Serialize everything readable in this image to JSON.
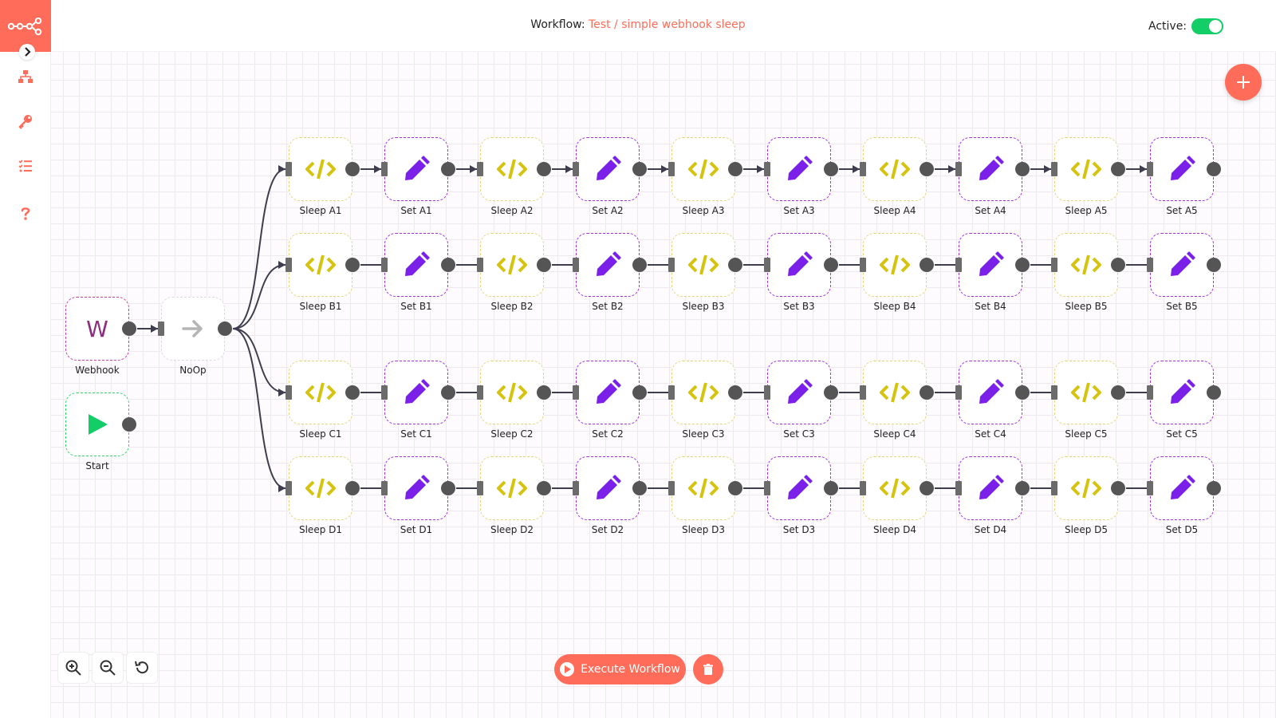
{
  "header": {
    "workflow_label": "Workflow:",
    "project": "Test",
    "separator": " / ",
    "workflow_name": "simple webhook sleep",
    "active_label": "Active:",
    "active": true
  },
  "sidebar": {
    "items": [
      {
        "name": "workflows",
        "icon": "network-icon"
      },
      {
        "name": "credentials",
        "icon": "key-icon"
      },
      {
        "name": "executions",
        "icon": "tasks-list-icon"
      },
      {
        "name": "help",
        "icon": "question-icon"
      }
    ]
  },
  "colors": {
    "accent": "#ff6d5a",
    "set": "#7b20e8",
    "sleep": "#d4c40d",
    "start": "#13ce66",
    "webhook": "#8c2e7e"
  },
  "nodes": {
    "webhook": {
      "label": "Webhook",
      "glyph": "W"
    },
    "noop": {
      "label": "NoOp"
    },
    "start": {
      "label": "Start"
    },
    "rows": [
      [
        "Sleep A1",
        "Set A1",
        "Sleep A2",
        "Set A2",
        "Sleep A3",
        "Set A3",
        "Sleep A4",
        "Set A4",
        "Sleep A5",
        "Set A5"
      ],
      [
        "Sleep B1",
        "Set B1",
        "Sleep B2",
        "Set B2",
        "Sleep B3",
        "Set B3",
        "Sleep B4",
        "Set B4",
        "Sleep B5",
        "Set B5"
      ],
      [
        "Sleep C1",
        "Set C1",
        "Sleep C2",
        "Set C2",
        "Sleep C3",
        "Set C3",
        "Sleep C4",
        "Set C4",
        "Sleep C5",
        "Set C5"
      ],
      [
        "Sleep D1",
        "Set D1",
        "Sleep D2",
        "Set D2",
        "Sleep D3",
        "Set D3",
        "Sleep D4",
        "Set D4",
        "Sleep D5",
        "Set D5"
      ]
    ]
  },
  "footer": {
    "execute_label": "Execute Workflow"
  }
}
